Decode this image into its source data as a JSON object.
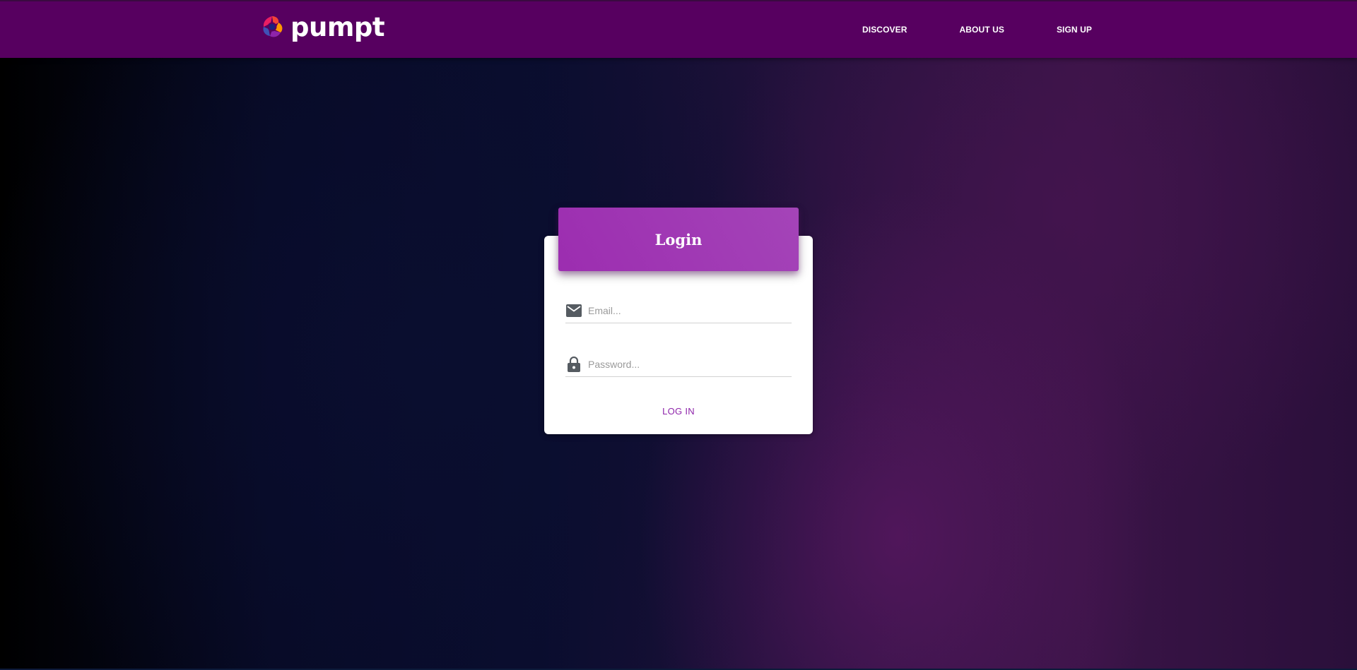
{
  "navbar": {
    "brand": "pumpt",
    "links": [
      {
        "label": "DISCOVER"
      },
      {
        "label": "ABOUT US"
      },
      {
        "label": "SIGN UP"
      }
    ],
    "background_color": "#570060"
  },
  "login_card": {
    "title": "Login",
    "email": {
      "value": "",
      "placeholder": "Email...",
      "icon": "email-icon"
    },
    "password": {
      "value": "",
      "placeholder": "Password...",
      "icon": "lock-icon"
    },
    "submit_label": "LOG IN",
    "header_color": "#9c2db0",
    "submit_color": "#8e24aa"
  }
}
